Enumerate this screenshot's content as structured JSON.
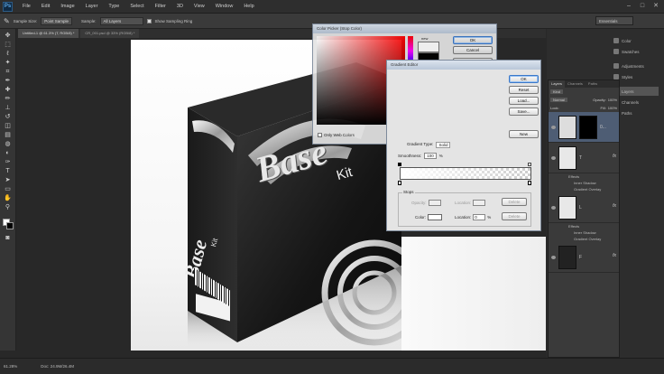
{
  "menu": {
    "logo": "Ps",
    "items": [
      "File",
      "Edit",
      "Image",
      "Layer",
      "Type",
      "Select",
      "Filter",
      "3D",
      "View",
      "Window",
      "Help"
    ]
  },
  "options_bar": {
    "sample_size_label": "Sample Size:",
    "sample_size_value": "Point Sample",
    "sample_label": "Sample:",
    "sample_value": "All Layers",
    "show_ring_label": "Show Sampling Ring"
  },
  "workspace": "Essentials",
  "doc_tabs": [
    "Untitled-1 @ 61.3% (T, RGB/8) *",
    "CR_001.psd @ 33% (RGB/8) *"
  ],
  "artwork": {
    "brand_front": "Base",
    "kit_front": "Kit",
    "brand_side": "Base",
    "kit_side": "Kit"
  },
  "status": {
    "zoom": "61.28%",
    "doc": "Doc: 24.9M/26.4M"
  },
  "dock_panels": [
    "Color",
    "Swatches",
    "Adjustments",
    "Styles",
    "Layers",
    "Channels",
    "Paths"
  ],
  "layers_panel": {
    "tabs": [
      "Layers",
      "Channels",
      "Paths"
    ],
    "kind": "Kind",
    "blend": "Normal",
    "opacity_label": "Opacity:",
    "opacity": "100%",
    "lock_label": "Lock:",
    "fill_label": "Fill:",
    "fill": "100%",
    "layers": [
      {
        "name": "0...",
        "fx": "",
        "effects": []
      },
      {
        "name": "T",
        "fx": "fx",
        "effects": [
          "Effects",
          "Inner Shadow",
          "Gradient Overlay"
        ]
      },
      {
        "name": "L",
        "fx": "fx",
        "effects": [
          "Effects",
          "Inner Shadow",
          "Gradient Overlay"
        ]
      },
      {
        "name": "F",
        "fx": "fx",
        "effects": []
      }
    ]
  },
  "gradient_editor": {
    "title": "Gradient Editor",
    "ok": "OK",
    "reset": "Reset",
    "load": "Load...",
    "save": "Save...",
    "new_btn": "New",
    "gradient_type_label": "Gradient Type:",
    "gradient_type": "Solid",
    "smoothness_label": "Smoothness:",
    "smoothness": "100",
    "smoothness_unit": "%",
    "stops_label": "Stops",
    "opacity_label": "Opacity:",
    "location_label": "Location:",
    "delete_label": "Delete",
    "color_label": "Color:",
    "location_value": "0",
    "pct": "%"
  },
  "color_picker": {
    "title": "Color Picker (Stop Color)",
    "ok": "OK",
    "cancel": "Cancel",
    "add_swatches": "Add to Swatches",
    "color_libraries": "Color Libraries",
    "new_label": "new",
    "current_label": "current",
    "only_web": "Only Web Colors",
    "H": "H:",
    "S": "S:",
    "B": "B:",
    "R": "R:",
    "G": "G:",
    "Bb": "B:",
    "R_val": "255",
    "G_val": "255",
    "B_val": "255",
    "L": "L:",
    "a": "a:",
    "b": "b:",
    "L_val": "100",
    "a_val": "0",
    "b_val": "0",
    "C": "C:",
    "M": "M:",
    "Y": "Y:",
    "K": "K:",
    "C_val": "0",
    "M_val": "0",
    "Y_val": "0",
    "K_val": "0",
    "hex_label": "#",
    "hex": "ffffff",
    "pct": "%"
  }
}
